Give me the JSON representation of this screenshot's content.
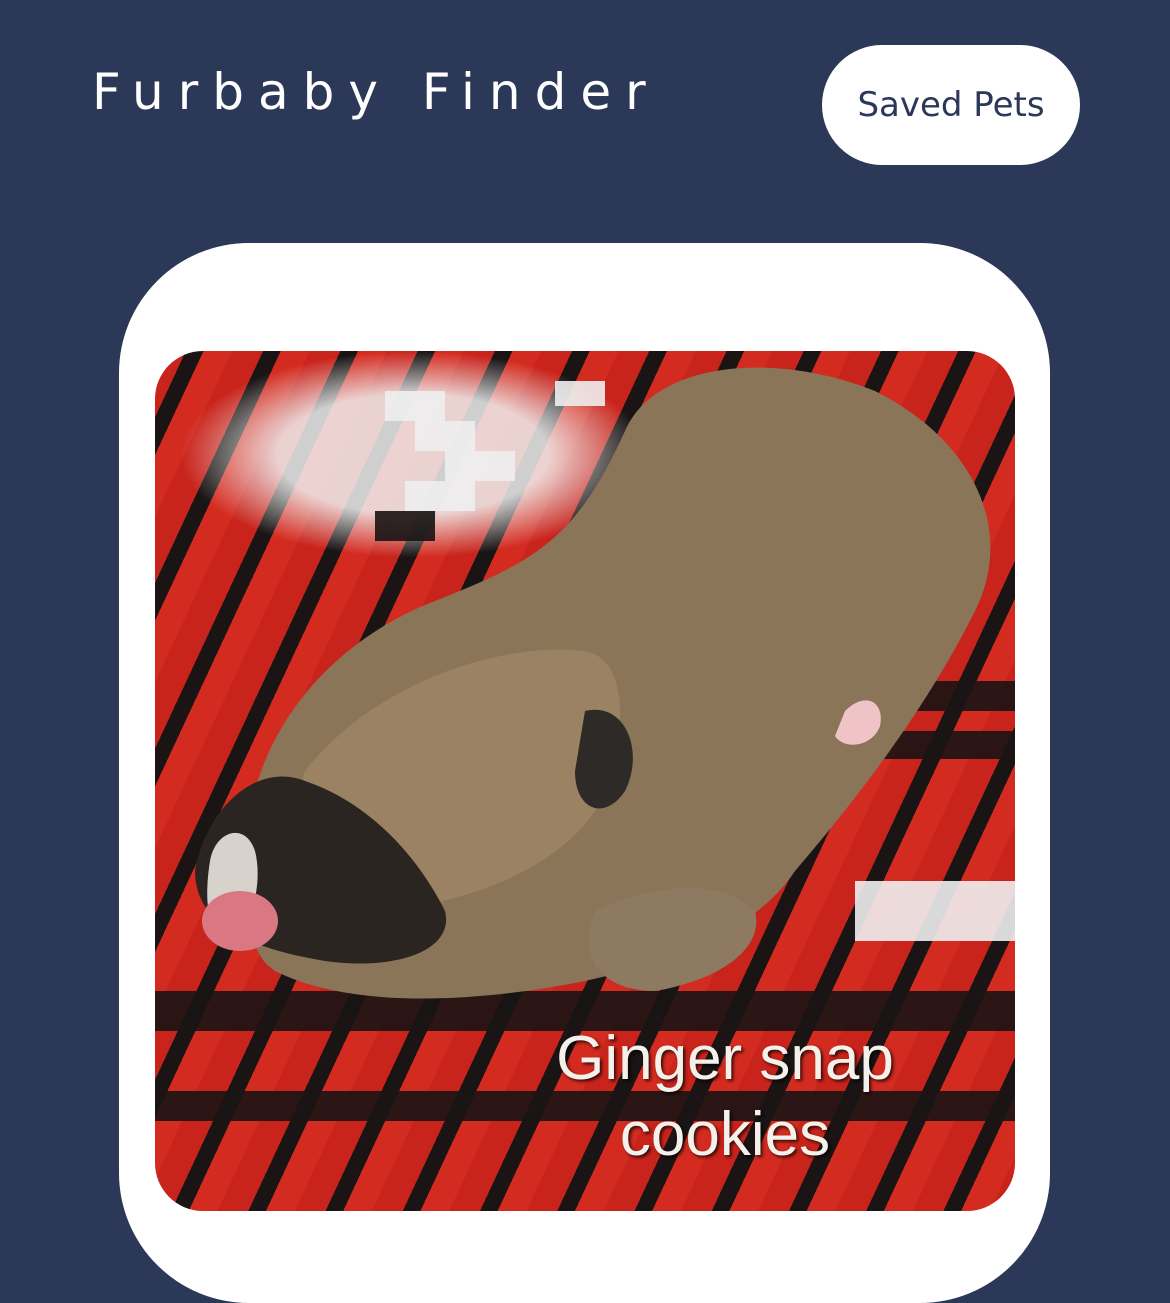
{
  "header": {
    "title": "Furbaby Finder",
    "saved_pets_label": "Saved Pets"
  },
  "pet_card": {
    "photo_caption": "Ginger snap cookies",
    "photo_subject": "puppy-photo"
  },
  "colors": {
    "background": "#2c3858",
    "card": "#ffffff",
    "button_text": "#2c3858"
  }
}
